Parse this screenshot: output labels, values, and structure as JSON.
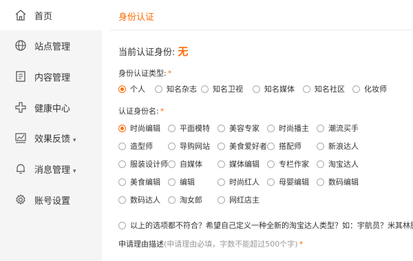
{
  "sidebar": {
    "items": [
      {
        "label": "首页",
        "icon": "home-icon",
        "caret": ""
      },
      {
        "label": "站点管理",
        "icon": "globe-icon",
        "caret": ""
      },
      {
        "label": "内容管理",
        "icon": "document-icon",
        "caret": ""
      },
      {
        "label": "健康中心",
        "icon": "health-icon",
        "caret": ""
      },
      {
        "label": "效果反馈",
        "icon": "chart-icon",
        "caret": "▾"
      },
      {
        "label": "消息管理",
        "icon": "bell-icon",
        "caret": "▾"
      },
      {
        "label": "账号设置",
        "icon": "gear-icon",
        "caret": ""
      }
    ]
  },
  "header": {
    "breadcrumb": "身份认证"
  },
  "status": {
    "label": "当前认证身份:",
    "value": "无"
  },
  "type_section": {
    "label": "身份认证类型:",
    "required": "*",
    "options": [
      "个人",
      "知名杂志",
      "知名卫视",
      "知名媒体",
      "知名社区",
      "化妆师"
    ],
    "selected": 0
  },
  "identity_section": {
    "label": "认证身份名:",
    "required": "*",
    "options": [
      "时尚编辑",
      "平面模特",
      "美容专家",
      "时尚播主",
      "潮流买手",
      "造型师",
      "导购网站",
      "美食爱好者",
      "搭配师",
      "新浪达人",
      "服装设计师",
      "自媒体",
      "媒体编辑",
      "专栏作家",
      "淘宝达人",
      "美食编辑",
      "编辑",
      "时尚红人",
      "母婴编辑",
      "数码编辑",
      "数码达人",
      "淘女郎",
      "网红店主"
    ],
    "selected": 0
  },
  "custom_option": "以上的选项都不符合？希望自己定义一种全新的淘宝达人类型？如：宇航员？米其林厨师？",
  "reason": {
    "label": "申请理由描述",
    "hint": "(申请理由必填，字数不能超过500个字)",
    "required": "*"
  },
  "colors": {
    "accent": "#ff6a00",
    "sidebar_bg": "#f5f5f5"
  }
}
